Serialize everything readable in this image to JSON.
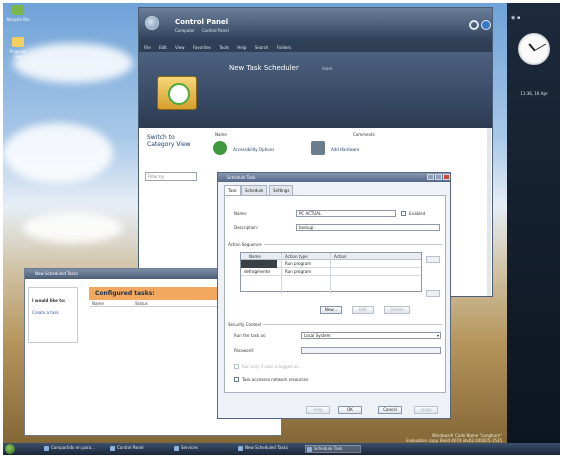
{
  "desktop": {
    "icons": [
      {
        "label": "Recycle Bin",
        "icon": "recycle-bin-icon",
        "color": "#7ab648"
      },
      {
        "label": "Program Files",
        "icon": "folder-icon",
        "color": "#f2cf5e"
      }
    ],
    "watermark_line1": "Windows® Code Name \"Longhorn\"",
    "watermark_line2": "Evaluation copy. Build 4074.idx02.040425-1535"
  },
  "sidebar": {
    "time": "11:36, 16 Apr"
  },
  "control_panel": {
    "title": "Control Panel",
    "breadcrumb": [
      "Computer",
      "Control Panel"
    ],
    "menu": [
      "File",
      "Edit",
      "View",
      "Favorites",
      "Tools",
      "Help",
      "Search",
      "Folders"
    ],
    "banner_title": "New Task Scheduler",
    "banner_sub": "more",
    "switch_link": "Switch to Category View",
    "filter_placeholder": "Filter by",
    "col_name": "Name",
    "col_comments": "Comments",
    "items": [
      {
        "label": "Accessibility Options",
        "icon": "accessibility-icon",
        "color": "#3e9a3e"
      },
      {
        "label": "Add Hardware",
        "icon": "add-hardware-icon",
        "color": "#6a7d8c"
      }
    ]
  },
  "scheduled_tasks": {
    "title": "New Scheduled Tasks",
    "sidebar_heading": "I would like to:",
    "sidebar_link": "Create a task",
    "header": "Configured tasks:",
    "header_color": "#f2a85e",
    "columns": [
      "Name",
      "Status"
    ]
  },
  "dialog": {
    "title": "Schedule Task",
    "tabs": [
      "Task",
      "Schedule",
      "Settings"
    ],
    "name_label": "Name:",
    "name_value": "PC ACTUAL",
    "enabled_label": "Enabled",
    "description_label": "Description:",
    "description_value": "backup",
    "action_sequence_label": "Action Sequence",
    "action_columns": [
      "Name",
      "Action type",
      "Action"
    ],
    "action_rows": [
      {
        "name": "",
        "type": "Run program",
        "action": ""
      },
      {
        "name": "defragmente",
        "type": "Run program",
        "action": ""
      }
    ],
    "new_button": "New...",
    "edit_button": "Edit",
    "delete_button": "Delete",
    "security_label": "Security Context",
    "run_as_label": "Run the task as:",
    "run_as_value": "Local System",
    "password_label": "Password:",
    "password_value": "",
    "only_logged_label": "Run only if user is logged on",
    "network_label": "Task accesses network resources",
    "help_button": "Help",
    "ok_button": "OK",
    "cancel_button": "Cancel",
    "apply_button": "Apply"
  },
  "taskbar": {
    "buttons": [
      {
        "label": "Compartido en para..."
      },
      {
        "label": "Control Panel"
      },
      {
        "label": "Services"
      },
      {
        "label": "New Scheduled Tasks"
      },
      {
        "label": "Schedule Task"
      }
    ]
  }
}
